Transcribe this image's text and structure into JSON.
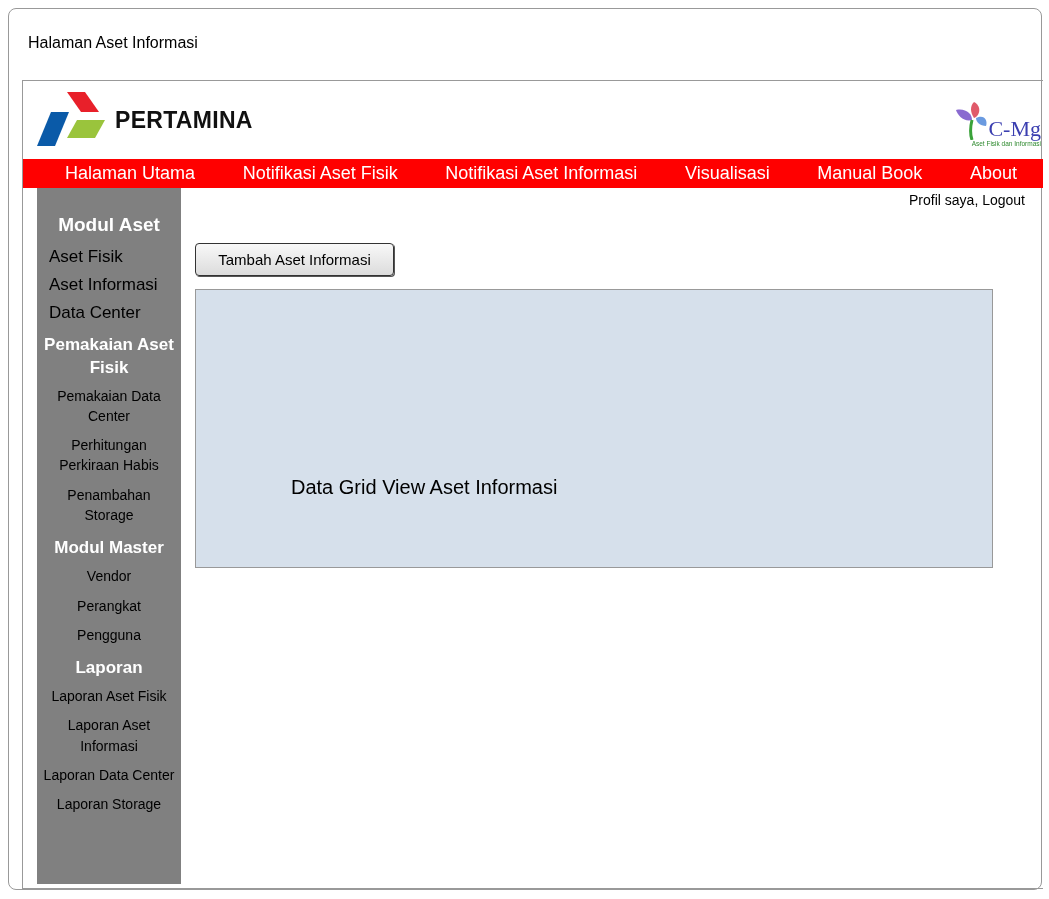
{
  "window": {
    "title": "Halaman Aset Informasi"
  },
  "header": {
    "brand": "PERTAMINA",
    "app_logo": {
      "name": "C-Mg",
      "tagline": "Aset Fisik dan Informasi"
    }
  },
  "nav": [
    "Halaman Utama",
    "Notifikasi Aset Fisik",
    "Notifikasi Aset Informasi",
    "Visualisasi",
    "Manual Book",
    "About"
  ],
  "sidebar": {
    "items": [
      {
        "kind": "heading",
        "label": "Modul Aset"
      },
      {
        "kind": "item",
        "label": "Aset Fisik"
      },
      {
        "kind": "item",
        "label": "Aset Informasi"
      },
      {
        "kind": "item",
        "label": "Data Center"
      },
      {
        "kind": "heading",
        "label": "Pemakaian Aset Fisik"
      },
      {
        "kind": "subitem",
        "label": "Pemakaian Data Center"
      },
      {
        "kind": "subitem",
        "label": "Perhitungan Perkiraan Habis"
      },
      {
        "kind": "subitem",
        "label": "Penambahan Storage"
      },
      {
        "kind": "heading",
        "label": "Modul Master"
      },
      {
        "kind": "subitem",
        "label": "Vendor"
      },
      {
        "kind": "subitem",
        "label": "Perangkat"
      },
      {
        "kind": "subitem",
        "label": "Pengguna"
      },
      {
        "kind": "heading",
        "label": "Laporan"
      },
      {
        "kind": "subitem",
        "label": "Laporan Aset Fisik"
      },
      {
        "kind": "subitem",
        "label": "Laporan Aset Informasi"
      },
      {
        "kind": "subitem",
        "label": "Laporan Data Center"
      },
      {
        "kind": "subitem",
        "label": "Laporan Storage"
      }
    ]
  },
  "user_links": "Profil saya, Logout",
  "add_button": "Tambah Aset Informasi",
  "grid_placeholder": "Data Grid View Aset Informasi"
}
